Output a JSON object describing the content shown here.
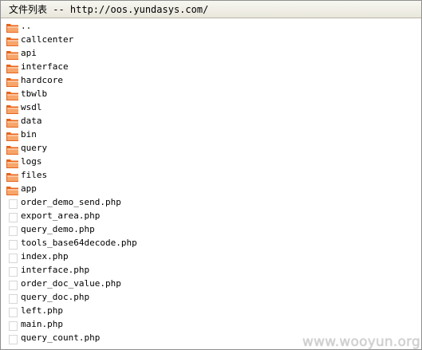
{
  "window": {
    "title": "文件列表 -- http://oos.yundasys.com/"
  },
  "entries": [
    {
      "name": "..",
      "type": "folder"
    },
    {
      "name": "callcenter",
      "type": "folder"
    },
    {
      "name": "api",
      "type": "folder"
    },
    {
      "name": "interface",
      "type": "folder"
    },
    {
      "name": "hardcore",
      "type": "folder"
    },
    {
      "name": "tbwlb",
      "type": "folder"
    },
    {
      "name": "wsdl",
      "type": "folder"
    },
    {
      "name": "data",
      "type": "folder"
    },
    {
      "name": "bin",
      "type": "folder"
    },
    {
      "name": "query",
      "type": "folder"
    },
    {
      "name": "logs",
      "type": "folder"
    },
    {
      "name": "files",
      "type": "folder"
    },
    {
      "name": "app",
      "type": "folder"
    },
    {
      "name": "order_demo_send.php",
      "type": "file"
    },
    {
      "name": "export_area.php",
      "type": "file"
    },
    {
      "name": "query_demo.php",
      "type": "file"
    },
    {
      "name": "tools_base64decode.php",
      "type": "file"
    },
    {
      "name": "index.php",
      "type": "file"
    },
    {
      "name": "interface.php",
      "type": "file"
    },
    {
      "name": "order_doc_value.php",
      "type": "file"
    },
    {
      "name": "query_doc.php",
      "type": "file"
    },
    {
      "name": "left.php",
      "type": "file"
    },
    {
      "name": "main.php",
      "type": "file"
    },
    {
      "name": "query_count.php",
      "type": "file"
    }
  ],
  "icons": {
    "folder": "folder-icon",
    "file": "file-icon"
  },
  "colors": {
    "folder_orange": "#e8641a",
    "folder_light": "#f7a56a",
    "file_border": "#d6d6d6"
  },
  "watermark": "www.wooyun.org"
}
